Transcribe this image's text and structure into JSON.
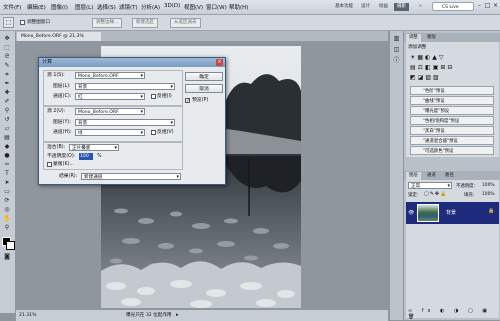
{
  "menubar": {
    "items": [
      "文件(F)",
      "编辑(E)",
      "图像(I)",
      "图层(L)",
      "选择(S)",
      "滤镜(T)",
      "分析(A)",
      "3D(D)",
      "视图(V)",
      "窗口(W)",
      "帮助(H)"
    ],
    "workspaces": [
      "基本功能",
      "设计",
      "绘画",
      "摄影"
    ],
    "active_workspace": "摄影",
    "search_label": "CS Live"
  },
  "optbar": {
    "checkbox_label": "调整图窗口",
    "buttons": [
      "调整边缘...",
      "新建选区",
      "从选区减去"
    ]
  },
  "document": {
    "tab_title": "Mono_Before.ORF @ 21.3%(RGB/8*) ×",
    "zoom": "21.31%",
    "status": "曝光只在 32 位起作用"
  },
  "dialog": {
    "title": "计算",
    "source1_label": "源 1(S):",
    "source1_value": "Mono_Before.ORF",
    "layer1_label": "图层(L):",
    "layer1_value": "背景",
    "channel1_label": "通道(C):",
    "channel1_value": "红",
    "invert1_label": "反相(I)",
    "source2_label": "源 2(U):",
    "source2_value": "Mono_Before.ORF",
    "layer2_label": "图层(Y):",
    "layer2_value": "背景",
    "channel2_label": "通道(H):",
    "channel2_value": "绿",
    "invert2_label": "反相(V)",
    "blend_label": "混合(B):",
    "blend_value": "正片叠底",
    "opacity_label": "不透明度(O):",
    "opacity_value": "100",
    "opacity_unit": "%",
    "mask_label": "蒙版(K)...",
    "result_label": "结果(R):",
    "result_value": "新建通道",
    "ok_label": "确定",
    "cancel_label": "取消",
    "preview_label": "预览(P)"
  },
  "adjust_panel": {
    "tabs": [
      "调整",
      "蒙版"
    ],
    "title": "添加调整",
    "presets": [
      "\"色阶\"预设",
      "\"曲线\"预设",
      "\"曝光度\"预设",
      "\"色相/饱和度\"预设",
      "\"黑白\"预设",
      "\"通道混合器\"预设",
      "\"可选颜色\"预设"
    ]
  },
  "layers_panel": {
    "tabs": [
      "图层",
      "通道",
      "路径"
    ],
    "blend_mode": "正常",
    "opacity_label": "不透明度:",
    "opacity_value": "100%",
    "lock_label": "锁定:",
    "fill_label": "填充:",
    "fill_value": "100%",
    "layer_name": "背景",
    "layer_highlight_color": "#1e2a7c"
  }
}
